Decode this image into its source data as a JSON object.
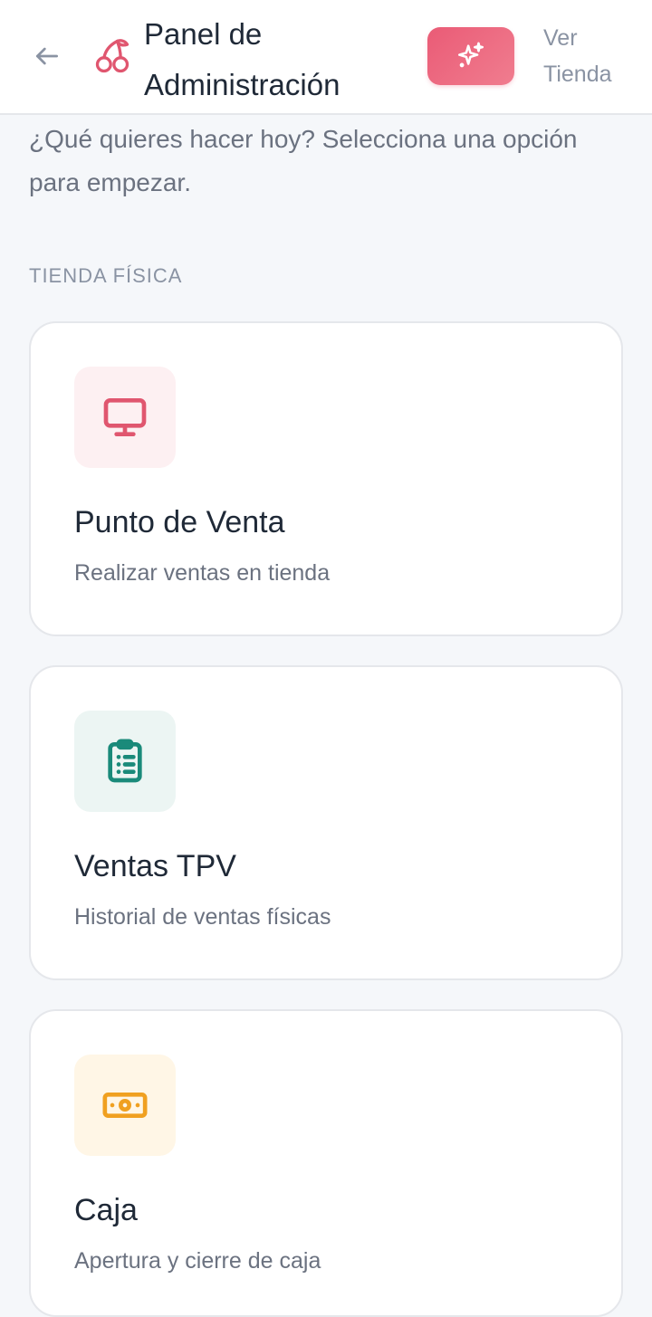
{
  "header": {
    "back_icon": "arrow-left-icon",
    "logo_icon": "cherry-icon",
    "title": "Panel de Administración",
    "magic_icon": "sparkles-icon",
    "store_link": "Ver Tienda"
  },
  "intro": {
    "text": "¿Qué quieres hacer hoy? Selecciona una opción para empezar."
  },
  "sections": [
    {
      "label": "TIENDA FÍSICA",
      "cards": [
        {
          "title": "Punto de Venta",
          "subtitle": "Realizar ventas en tienda",
          "icon": "monitor-icon",
          "color": "#e0566f",
          "bg": "#fdf0f2"
        },
        {
          "title": "Ventas TPV",
          "subtitle": "Historial de ventas físicas",
          "icon": "clipboard-list-icon",
          "color": "#1a8a7a",
          "bg": "#ecf5f3"
        },
        {
          "title": "Caja",
          "subtitle": "Apertura y cierre de caja",
          "icon": "cash-icon",
          "color": "#f0a020",
          "bg": "#fff6e6"
        }
      ]
    }
  ],
  "colors": {
    "accent": "#ea5b76",
    "background": "#f5f7fa"
  }
}
